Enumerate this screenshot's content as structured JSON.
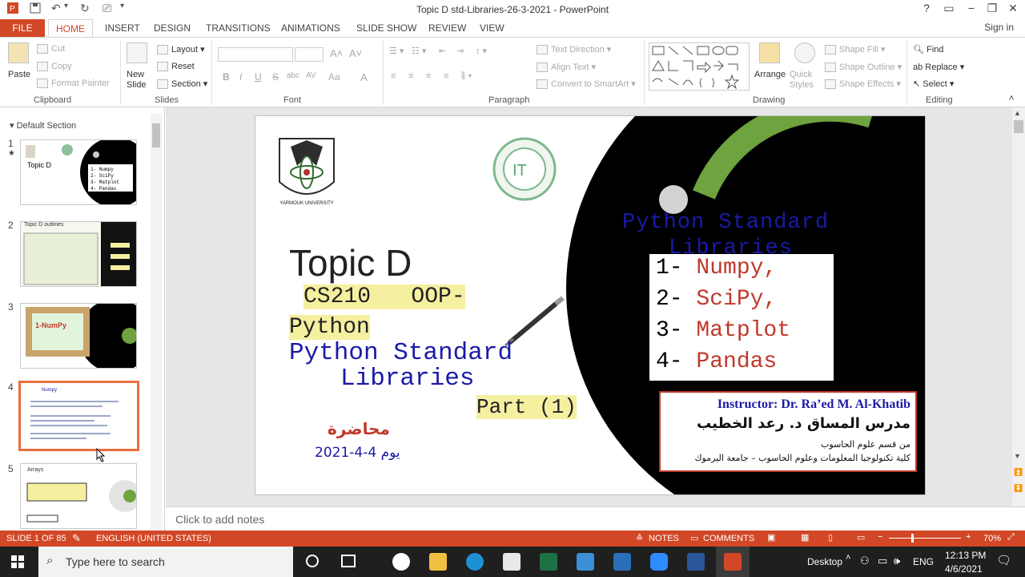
{
  "window": {
    "title": "Topic D std-Libraries-26-3-2021 - PowerPoint",
    "sign_in": "Sign in",
    "help": "?",
    "minimize": "−",
    "restore": "❐",
    "close": "✕"
  },
  "tabs": [
    "FILE",
    "HOME",
    "INSERT",
    "DESIGN",
    "TRANSITIONS",
    "ANIMATIONS",
    "SLIDE SHOW",
    "REVIEW",
    "VIEW"
  ],
  "ribbon": {
    "clipboard": {
      "label": "Clipboard",
      "paste": "Paste",
      "cut": "Cut",
      "copy": "Copy",
      "format_painter": "Format Painter"
    },
    "slides": {
      "label": "Slides",
      "new_slide": "New Slide",
      "layout": "Layout",
      "reset": "Reset",
      "section": "Section"
    },
    "font": {
      "label": "Font",
      "bold": "B",
      "italic": "I",
      "underline": "U",
      "strike": "S",
      "shadow": "abc",
      "spacing": "AV",
      "case": "Aa",
      "color": "A"
    },
    "paragraph": {
      "label": "Paragraph",
      "text_direction": "Text Direction",
      "align_text": "Align Text",
      "convert_smartart": "Convert to SmartArt"
    },
    "drawing": {
      "label": "Drawing",
      "arrange": "Arrange",
      "quick_styles": "Quick Styles",
      "shape_fill": "Shape Fill",
      "shape_outline": "Shape Outline",
      "shape_effects": "Shape Effects"
    },
    "editing": {
      "label": "Editing",
      "find": "Find",
      "replace": "Replace",
      "select": "Select"
    }
  },
  "left_pane": {
    "section": "Default Section",
    "thumbnails": [
      {
        "num": "1",
        "title": "Topic D"
      },
      {
        "num": "2",
        "title": "Topic D outlines"
      },
      {
        "num": "3",
        "title": "1-NumPy"
      },
      {
        "num": "4",
        "title": "Numpy"
      },
      {
        "num": "5",
        "title": "Arrays"
      }
    ]
  },
  "slide": {
    "title": "Topic D",
    "course_line1": "CS210   OOP-",
    "course_line2": "Python",
    "subtitle_line1": "Python Standard",
    "subtitle_line2": "Libraries",
    "part": "Part (1)",
    "lecture_ar": "محاضرة",
    "date": "2021-4-4 يوم",
    "heading_right_line1": "Python Standard",
    "heading_right_line2": "Libraries",
    "list": [
      {
        "n": "1-",
        "text": "Numpy,"
      },
      {
        "n": "2-",
        "text": "SciPy,"
      },
      {
        "n": "3-",
        "text": "Matplot"
      },
      {
        "n": "4-",
        "text": "Pandas"
      }
    ],
    "instructor_en": "Instructor: Dr. Ra’ed M. Al-Khatib",
    "instructor_ar": "مدرس المساق د. رعد الخطيب",
    "dept_ar": "من قسم علوم الحاسوب",
    "college_ar": "كلية تكنولوجيا المعلومات وعلوم الحاسوب – جامعة اليرموك",
    "logo_text": "YARMOUK UNIVERSITY"
  },
  "notes": {
    "placeholder": "Click to add notes"
  },
  "status": {
    "slide": "SLIDE 1 OF 85",
    "language": "ENGLISH (UNITED STATES)",
    "notes": "NOTES",
    "comments": "COMMENTS",
    "zoom": "70%"
  },
  "taskbar": {
    "search_placeholder": "Type here to search",
    "desktop": "Desktop",
    "lang": "ENG",
    "time": "12:13 PM",
    "date": "4/6/2021"
  },
  "colors": {
    "accent": "#d24726",
    "slide_blue": "#1a1aa8",
    "slide_red": "#c0392b",
    "highlight": "#f5f0a0",
    "green": "#6ea33f"
  }
}
